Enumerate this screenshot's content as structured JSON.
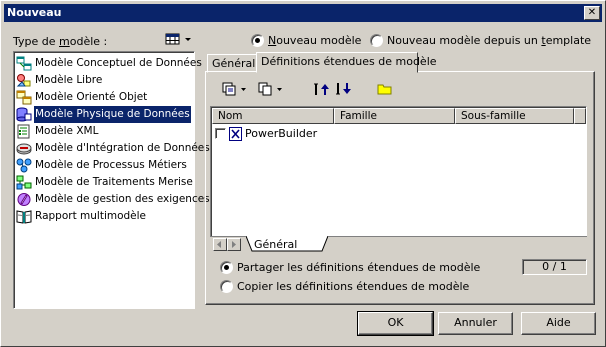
{
  "window": {
    "title": "Nouveau",
    "close_glyph": "✕"
  },
  "left": {
    "type_label_pre": "Type de ",
    "type_label_u": "m",
    "type_label_post": "odèle :",
    "view_menu_icon": "large-icons-view-icon",
    "models": [
      {
        "label": "Modèle Conceptuel de Données",
        "icon": "conceptual-data-model-icon"
      },
      {
        "label": "Modèle Libre",
        "icon": "free-model-icon"
      },
      {
        "label": "Modèle Orienté Objet",
        "icon": "object-oriented-model-icon"
      },
      {
        "label": "Modèle Physique de Données",
        "icon": "physical-data-model-icon",
        "selected": true
      },
      {
        "label": "Modèle XML",
        "icon": "xml-model-icon"
      },
      {
        "label": "Modèle d'Intégration de Données",
        "icon": "data-integration-model-icon"
      },
      {
        "label": "Modèle de Processus Métiers",
        "icon": "business-process-model-icon"
      },
      {
        "label": "Modèle de Traitements Merise",
        "icon": "merise-model-icon"
      },
      {
        "label": "Modèle de gestion des exigences",
        "icon": "requirements-model-icon"
      },
      {
        "label": "Rapport multimodèle",
        "icon": "multimodel-report-icon"
      }
    ]
  },
  "mode": {
    "new_model_pre": "",
    "new_model_u": "N",
    "new_model_post": "ouveau modèle",
    "from_template_pre": "Nouveau modèle depuis un ",
    "from_template_u": "t",
    "from_template_post": "emplate",
    "selected": "new_model"
  },
  "tabs": [
    {
      "label": "Général",
      "active": false
    },
    {
      "label": "Définitions étendues de modèle",
      "active": true
    }
  ],
  "grid": {
    "columns": [
      "Nom",
      "Famille",
      "Sous-famille"
    ],
    "rows": [
      {
        "name": "PowerBuilder",
        "checked": false
      }
    ],
    "sheet_tab": "Général"
  },
  "share": {
    "share_label": "Partager les définitions étendues de modèle",
    "copy_label": "Copier les définitions étendues de modèle",
    "selected": "share",
    "counter": "0 / 1"
  },
  "buttons": {
    "ok": "OK",
    "cancel": "Annuler",
    "help": "Aide"
  },
  "colors": {
    "titlebar": "#0a246a",
    "face": "#d4d0c8",
    "selection": "#0a246a"
  }
}
